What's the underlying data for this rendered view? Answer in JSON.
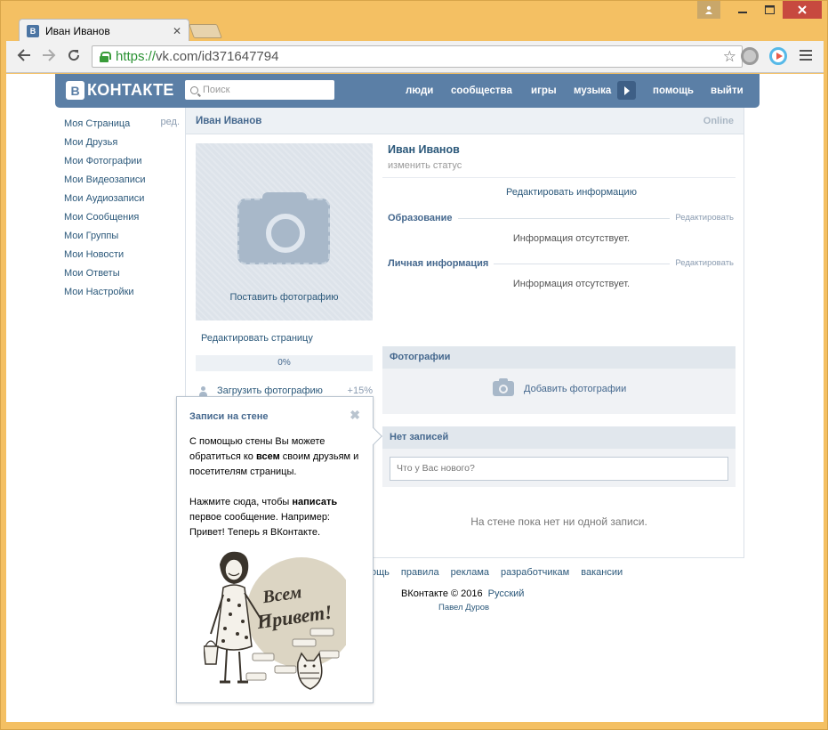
{
  "browser": {
    "tab_title": "Иван Иванов",
    "tab_favicon": "В",
    "url_scheme": "https://",
    "url_rest": "vk.com/id371647794",
    "window_controls": [
      "user-icon",
      "minimize-icon",
      "maximize-icon",
      "close-icon"
    ]
  },
  "header": {
    "logo_letter": "В",
    "logo_text": "КОНТАКТЕ",
    "search_placeholder": "Поиск",
    "nav": [
      "люди",
      "сообщества",
      "игры",
      "музыка",
      "помощь",
      "выйти"
    ],
    "accent": "#5b7fa6"
  },
  "left_menu": {
    "edit_label": "ред.",
    "items": [
      "Моя Страница",
      "Мои Друзья",
      "Мои Фотографии",
      "Мои Видеозаписи",
      "Мои Аудиозаписи",
      "Мои Сообщения",
      "Мои Группы",
      "Мои Новости",
      "Мои Ответы",
      "Мои Настройки"
    ]
  },
  "profile": {
    "header_name": "Иван Иванов",
    "online": "Online",
    "avatar_caption": "Поставить фотографию",
    "edit_page": "Редактировать страницу",
    "progress": "0%",
    "progress_value": 0,
    "upload_label": "Загрузить фотографию",
    "upload_bonus": "+15%",
    "name": "Иван Иванов",
    "status": "изменить статус",
    "edit_info": "Редактировать информацию",
    "sections": [
      {
        "title": "Образование",
        "edit": "Редактировать",
        "empty": "Информация отсутствует."
      },
      {
        "title": "Личная информация",
        "edit": "Редактировать",
        "empty": "Информация отсутствует."
      }
    ]
  },
  "photos": {
    "title": "Фотографии",
    "add": "Добавить фотографии"
  },
  "wall": {
    "title": "Нет записей",
    "placeholder": "Что у Вас нового?",
    "empty": "На стене пока нет ни одной записи."
  },
  "footer": {
    "links": [
      "ощь",
      "правила",
      "реклама",
      "разработчикам",
      "вакансии"
    ],
    "copyright": "ВКонтакте © 2016",
    "language": "Русский",
    "author": "Павел Дуров"
  },
  "tooltip": {
    "title": "Записи на стене",
    "close": "✖",
    "p1_a": "С помощью стены Вы можете обратиться ко ",
    "p1_b": "всем",
    "p1_c": " своим друзьям и посетителям страницы.",
    "p2_a": "Нажмите сюда, чтобы ",
    "p2_b": "написать",
    "p2_c": " первое сообщение. Например: Привет! Теперь я ВКонтакте.",
    "illustration_text": "Всем Привет!"
  }
}
